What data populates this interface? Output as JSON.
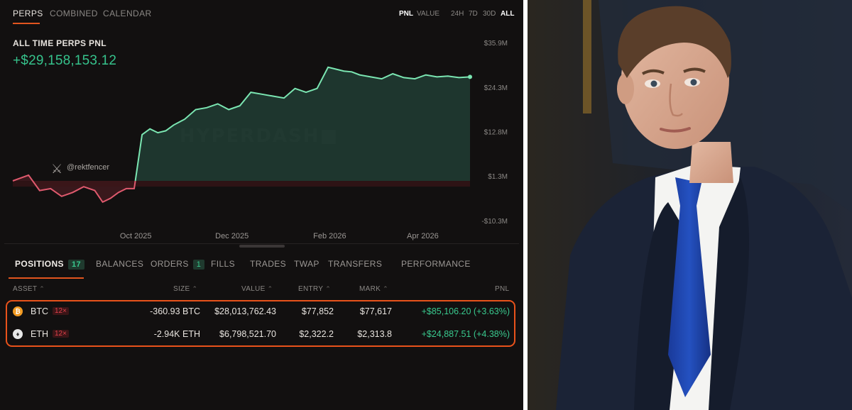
{
  "nav": {
    "tabs": [
      "PERPS",
      "COMBINED",
      "CALENDAR"
    ],
    "metric_toggle": [
      "PNL",
      "VALUE"
    ],
    "ranges": [
      "24H",
      "7D",
      "30D",
      "ALL"
    ]
  },
  "pnl": {
    "title": "ALL TIME PERPS PNL",
    "value": "+$29,158,153.12"
  },
  "chart_data": {
    "type": "area",
    "y_tick_labels": [
      "$35.9M",
      "$24.3M",
      "$12.8M",
      "$1.3M",
      "-$10.3M"
    ],
    "y_ticks": [
      35.9,
      24.3,
      12.8,
      1.3,
      -10.3
    ],
    "x_tick_labels": [
      "Oct 2025",
      "Dec 2025",
      "Feb 2026",
      "Apr 2026"
    ],
    "x_ticks": [
      "2025-10-01",
      "2025-12-01",
      "2026-02-01",
      "2026-04-01"
    ],
    "ylim": [
      -10.3,
      35.9
    ],
    "baseline": 0,
    "watermark": "HYPERDASH",
    "handle": "@rektfencer",
    "series": [
      {
        "x": [
          "2025-07-15",
          "2025-07-25",
          "2025-08-01",
          "2025-08-08",
          "2025-08-15",
          "2025-08-22",
          "2025-08-29",
          "2025-09-05",
          "2025-09-10",
          "2025-09-15",
          "2025-09-20",
          "2025-09-25",
          "2025-09-30",
          "2025-10-05",
          "2025-10-10",
          "2025-10-15",
          "2025-10-20",
          "2025-10-25",
          "2025-11-01",
          "2025-11-08",
          "2025-11-15",
          "2025-11-22",
          "2025-11-29",
          "2025-12-06",
          "2025-12-13",
          "2025-12-20",
          "2025-12-27",
          "2026-01-03",
          "2026-01-10",
          "2026-01-17",
          "2026-01-24",
          "2026-01-31",
          "2026-02-05",
          "2026-02-10",
          "2026-02-15",
          "2026-02-20",
          "2026-02-27",
          "2026-03-06",
          "2026-03-13",
          "2026-03-20",
          "2026-03-27",
          "2026-04-03",
          "2026-04-10",
          "2026-04-17",
          "2026-04-24",
          "2026-05-01"
        ],
        "y": [
          0.0,
          1.5,
          -2.5,
          -2.0,
          -4.0,
          -3.0,
          -1.5,
          -2.5,
          -5.5,
          -4.5,
          -3.0,
          -2.0,
          -2.0,
          12.0,
          13.5,
          12.5,
          13.0,
          14.5,
          16.0,
          18.5,
          19.0,
          20.0,
          18.5,
          19.5,
          23.0,
          22.5,
          22.0,
          21.5,
          24.0,
          23.0,
          24.0,
          29.5,
          29.0,
          28.5,
          28.3,
          27.5,
          27.0,
          26.5,
          27.8,
          26.8,
          26.5,
          27.5,
          27.0,
          27.2,
          26.8,
          27.0
        ]
      }
    ]
  },
  "positions": {
    "tabs": [
      {
        "label": "POSITIONS",
        "count": "17"
      },
      {
        "label": "BALANCES"
      },
      {
        "label": "ORDERS",
        "count": "1"
      },
      {
        "label": "FILLS"
      },
      {
        "label": "TRADES"
      },
      {
        "label": "TWAP"
      },
      {
        "label": "TRANSFERS"
      },
      {
        "label": "PERFORMANCE"
      }
    ],
    "columns": [
      "ASSET",
      "SIZE",
      "VALUE",
      "ENTRY",
      "MARK",
      "PNL"
    ],
    "rows": [
      {
        "icon": "bitcoin-icon",
        "asset": "BTC",
        "leverage": "12×",
        "size": "-360.93 BTC",
        "value": "$28,013,762.43",
        "entry": "$77,852",
        "mark": "$77,617",
        "pnl": "+$85,106.20 (+3.63%)"
      },
      {
        "icon": "ethereum-icon",
        "asset": "ETH",
        "leverage": "12×",
        "size": "-2.94K ETH",
        "value": "$6,798,521.70",
        "entry": "$2,322.2",
        "mark": "$2,313.8",
        "pnl": "+$24,887.51 (+4.38%)"
      }
    ]
  },
  "colors": {
    "accent": "#e2551f",
    "profit": "#36c38c",
    "loss": "#e05a6e",
    "background": "#121010"
  }
}
